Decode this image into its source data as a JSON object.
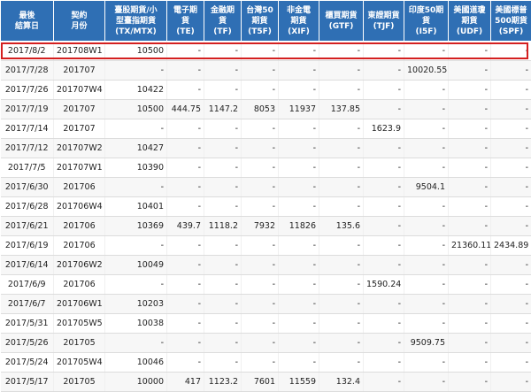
{
  "headers": [
    "最後\n結算日",
    "契約\n月份",
    "臺股期貨/小\n型臺指期貨\n(TX/MTX)",
    "電子期\n貨\n(TE)",
    "金融期\n貨\n(TF)",
    "台灣50\n期貨\n(T5F)",
    "非金電\n期貨\n(XIF)",
    "櫃買期貨\n(GTF)",
    "東證期貨\n(TJF)",
    "印度50期\n貨\n(I5F)",
    "美國道瓊\n期貨\n(UDF)",
    "美國標普\n500期貨\n(SPF)"
  ],
  "rows": [
    [
      "2017/8/2",
      "201708W1",
      "10500",
      "-",
      "-",
      "-",
      "-",
      "-",
      "-",
      "-",
      "-",
      "-"
    ],
    [
      "2017/7/28",
      "201707",
      "-",
      "-",
      "-",
      "-",
      "-",
      "-",
      "-",
      "10020.55",
      "-",
      "-"
    ],
    [
      "2017/7/26",
      "201707W4",
      "10422",
      "-",
      "-",
      "-",
      "-",
      "-",
      "-",
      "-",
      "-",
      "-"
    ],
    [
      "2017/7/19",
      "201707",
      "10500",
      "444.75",
      "1147.2",
      "8053",
      "11937",
      "137.85",
      "-",
      "-",
      "-",
      "-"
    ],
    [
      "2017/7/14",
      "201707",
      "-",
      "-",
      "-",
      "-",
      "-",
      "-",
      "1623.9",
      "-",
      "-",
      "-"
    ],
    [
      "2017/7/12",
      "201707W2",
      "10427",
      "-",
      "-",
      "-",
      "-",
      "-",
      "-",
      "-",
      "-",
      "-"
    ],
    [
      "2017/7/5",
      "201707W1",
      "10390",
      "-",
      "-",
      "-",
      "-",
      "-",
      "-",
      "-",
      "-",
      "-"
    ],
    [
      "2017/6/30",
      "201706",
      "-",
      "-",
      "-",
      "-",
      "-",
      "-",
      "-",
      "9504.1",
      "-",
      "-"
    ],
    [
      "2017/6/28",
      "201706W4",
      "10401",
      "-",
      "-",
      "-",
      "-",
      "-",
      "-",
      "-",
      "-",
      "-"
    ],
    [
      "2017/6/21",
      "201706",
      "10369",
      "439.7",
      "1118.2",
      "7932",
      "11826",
      "135.6",
      "-",
      "-",
      "-",
      "-"
    ],
    [
      "2017/6/19",
      "201706",
      "-",
      "-",
      "-",
      "-",
      "-",
      "-",
      "-",
      "-",
      "21360.11",
      "2434.89"
    ],
    [
      "2017/6/14",
      "201706W2",
      "10049",
      "-",
      "-",
      "-",
      "-",
      "-",
      "-",
      "-",
      "-",
      "-"
    ],
    [
      "2017/6/9",
      "201706",
      "-",
      "-",
      "-",
      "-",
      "-",
      "-",
      "1590.24",
      "-",
      "-",
      "-"
    ],
    [
      "2017/6/7",
      "201706W1",
      "10203",
      "-",
      "-",
      "-",
      "-",
      "-",
      "-",
      "-",
      "-",
      "-"
    ],
    [
      "2017/5/31",
      "201705W5",
      "10038",
      "-",
      "-",
      "-",
      "-",
      "-",
      "-",
      "-",
      "-",
      "-"
    ],
    [
      "2017/5/26",
      "201705",
      "-",
      "-",
      "-",
      "-",
      "-",
      "-",
      "-",
      "9509.75",
      "-",
      "-"
    ],
    [
      "2017/5/24",
      "201705W4",
      "10046",
      "-",
      "-",
      "-",
      "-",
      "-",
      "-",
      "-",
      "-",
      "-"
    ],
    [
      "2017/5/17",
      "201705",
      "10000",
      "417",
      "1123.2",
      "7601",
      "11559",
      "132.4",
      "-",
      "-",
      "-",
      "-"
    ]
  ],
  "colors": {
    "header_bg": "#2f6fb4",
    "highlight_border": "#d42020"
  }
}
